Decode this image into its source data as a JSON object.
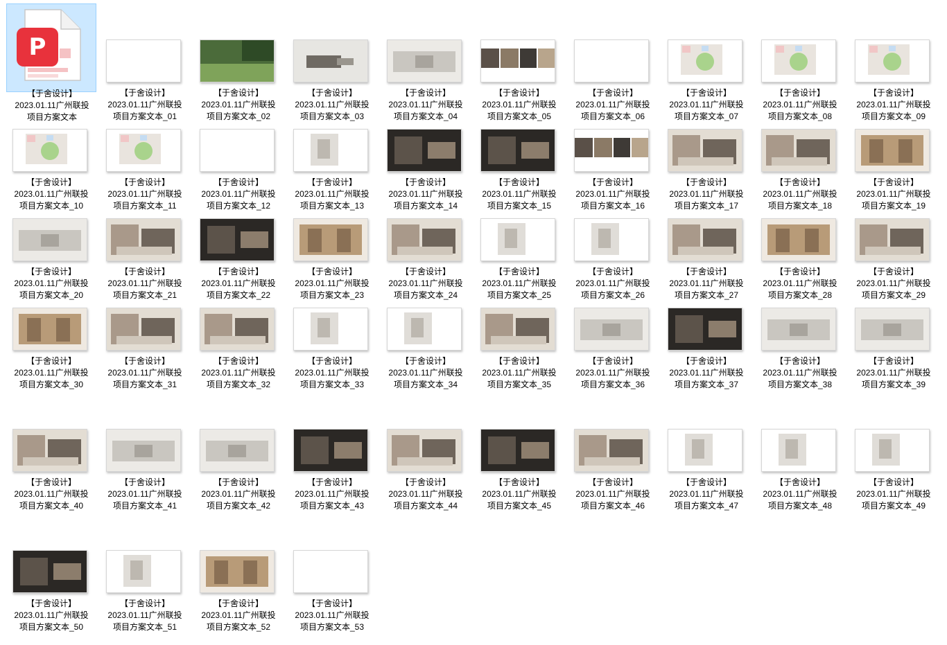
{
  "window": {
    "view": "large-icons"
  },
  "files": [
    {
      "l1": "【于舍设计】",
      "l2": "2023.01.11广州联投",
      "l3": "项目方案文本",
      "style": "pdf",
      "selected": true
    },
    {
      "l1": "【于舍设计】",
      "l2": "2023.01.11广州联投",
      "l3": "项目方案文本_01",
      "style": "blank"
    },
    {
      "l1": "【于舍设计】",
      "l2": "2023.01.11广州联投",
      "l3": "项目方案文本_02",
      "style": "green"
    },
    {
      "l1": "【于舍设计】",
      "l2": "2023.01.11广州联投",
      "l3": "项目方案文本_03",
      "style": "photo"
    },
    {
      "l1": "【于舍设计】",
      "l2": "2023.01.11广州联投",
      "l3": "项目方案文本_04",
      "style": "grey"
    },
    {
      "l1": "【于舍设计】",
      "l2": "2023.01.11广州联投",
      "l3": "项目方案文本_05",
      "style": "collage"
    },
    {
      "l1": "【于舍设计】",
      "l2": "2023.01.11广州联投",
      "l3": "项目方案文本_06",
      "style": "blank"
    },
    {
      "l1": "【于舍设计】",
      "l2": "2023.01.11广州联投",
      "l3": "项目方案文本_07",
      "style": "plan"
    },
    {
      "l1": "【于舍设计】",
      "l2": "2023.01.11广州联投",
      "l3": "项目方案文本_08",
      "style": "plan"
    },
    {
      "l1": "【于舍设计】",
      "l2": "2023.01.11广州联投",
      "l3": "项目方案文本_09",
      "style": "plan"
    },
    {
      "l1": "【于舍设计】",
      "l2": "2023.01.11广州联投",
      "l3": "项目方案文本_10",
      "style": "plan"
    },
    {
      "l1": "【于舍设计】",
      "l2": "2023.01.11广州联投",
      "l3": "项目方案文本_11",
      "style": "plan"
    },
    {
      "l1": "【于舍设计】",
      "l2": "2023.01.11广州联投",
      "l3": "项目方案文本_12",
      "style": "blank"
    },
    {
      "l1": "【于舍设计】",
      "l2": "2023.01.11广州联投",
      "l3": "项目方案文本_13",
      "style": "drawing"
    },
    {
      "l1": "【于舍设计】",
      "l2": "2023.01.11广州联投",
      "l3": "项目方案文本_14",
      "style": "dark"
    },
    {
      "l1": "【于舍设计】",
      "l2": "2023.01.11广州联投",
      "l3": "项目方案文本_15",
      "style": "dark"
    },
    {
      "l1": "【于舍设计】",
      "l2": "2023.01.11广州联投",
      "l3": "项目方案文本_16",
      "style": "collage"
    },
    {
      "l1": "【于舍设计】",
      "l2": "2023.01.11广州联投",
      "l3": "项目方案文本_17",
      "style": "interior"
    },
    {
      "l1": "【于舍设计】",
      "l2": "2023.01.11广州联投",
      "l3": "项目方案文本_18",
      "style": "interior"
    },
    {
      "l1": "【于舍设计】",
      "l2": "2023.01.11广州联投",
      "l3": "项目方案文本_19",
      "style": "wood"
    },
    {
      "l1": "【于舍设计】",
      "l2": "2023.01.11广州联投",
      "l3": "项目方案文本_20",
      "style": "grey"
    },
    {
      "l1": "【于舍设计】",
      "l2": "2023.01.11广州联投",
      "l3": "项目方案文本_21",
      "style": "interior"
    },
    {
      "l1": "【于舍设计】",
      "l2": "2023.01.11广州联投",
      "l3": "项目方案文本_22",
      "style": "dark"
    },
    {
      "l1": "【于舍设计】",
      "l2": "2023.01.11广州联投",
      "l3": "项目方案文本_23",
      "style": "wood"
    },
    {
      "l1": "【于舍设计】",
      "l2": "2023.01.11广州联投",
      "l3": "项目方案文本_24",
      "style": "interior"
    },
    {
      "l1": "【于舍设计】",
      "l2": "2023.01.11广州联投",
      "l3": "项目方案文本_25",
      "style": "drawing"
    },
    {
      "l1": "【于舍设计】",
      "l2": "2023.01.11广州联投",
      "l3": "项目方案文本_26",
      "style": "drawing"
    },
    {
      "l1": "【于舍设计】",
      "l2": "2023.01.11广州联投",
      "l3": "项目方案文本_27",
      "style": "interior"
    },
    {
      "l1": "【于舍设计】",
      "l2": "2023.01.11广州联投",
      "l3": "项目方案文本_28",
      "style": "wood"
    },
    {
      "l1": "【于舍设计】",
      "l2": "2023.01.11广州联投",
      "l3": "项目方案文本_29",
      "style": "interior"
    },
    {
      "l1": "【于舍设计】",
      "l2": "2023.01.11广州联投",
      "l3": "项目方案文本_30",
      "style": "wood"
    },
    {
      "l1": "【于舍设计】",
      "l2": "2023.01.11广州联投",
      "l3": "项目方案文本_31",
      "style": "interior"
    },
    {
      "l1": "【于舍设计】",
      "l2": "2023.01.11广州联投",
      "l3": "项目方案文本_32",
      "style": "interior"
    },
    {
      "l1": "【于舍设计】",
      "l2": "2023.01.11广州联投",
      "l3": "项目方案文本_33",
      "style": "drawing"
    },
    {
      "l1": "【于舍设计】",
      "l2": "2023.01.11广州联投",
      "l3": "项目方案文本_34",
      "style": "drawing"
    },
    {
      "l1": "【于舍设计】",
      "l2": "2023.01.11广州联投",
      "l3": "项目方案文本_35",
      "style": "interior"
    },
    {
      "l1": "【于舍设计】",
      "l2": "2023.01.11广州联投",
      "l3": "项目方案文本_36",
      "style": "grey"
    },
    {
      "l1": "【于舍设计】",
      "l2": "2023.01.11广州联投",
      "l3": "项目方案文本_37",
      "style": "dark"
    },
    {
      "l1": "【于舍设计】",
      "l2": "2023.01.11广州联投",
      "l3": "项目方案文本_38",
      "style": "grey"
    },
    {
      "l1": "【于舍设计】",
      "l2": "2023.01.11广州联投",
      "l3": "项目方案文本_39",
      "style": "grey"
    },
    {
      "l1": "【于舍设计】",
      "l2": "2023.01.11广州联投",
      "l3": "项目方案文本_40",
      "style": "interior"
    },
    {
      "l1": "【于舍设计】",
      "l2": "2023.01.11广州联投",
      "l3": "项目方案文本_41",
      "style": "grey"
    },
    {
      "l1": "【于舍设计】",
      "l2": "2023.01.11广州联投",
      "l3": "项目方案文本_42",
      "style": "grey"
    },
    {
      "l1": "【于舍设计】",
      "l2": "2023.01.11广州联投",
      "l3": "项目方案文本_43",
      "style": "dark"
    },
    {
      "l1": "【于舍设计】",
      "l2": "2023.01.11广州联投",
      "l3": "项目方案文本_44",
      "style": "interior"
    },
    {
      "l1": "【于舍设计】",
      "l2": "2023.01.11广州联投",
      "l3": "项目方案文本_45",
      "style": "dark"
    },
    {
      "l1": "【于舍设计】",
      "l2": "2023.01.11广州联投",
      "l3": "项目方案文本_46",
      "style": "interior"
    },
    {
      "l1": "【于舍设计】",
      "l2": "2023.01.11广州联投",
      "l3": "项目方案文本_47",
      "style": "drawing"
    },
    {
      "l1": "【于舍设计】",
      "l2": "2023.01.11广州联投",
      "l3": "项目方案文本_48",
      "style": "drawing"
    },
    {
      "l1": "【于舍设计】",
      "l2": "2023.01.11广州联投",
      "l3": "项目方案文本_49",
      "style": "drawing"
    },
    {
      "l1": "【于舍设计】",
      "l2": "2023.01.11广州联投",
      "l3": "项目方案文本_50",
      "style": "dark"
    },
    {
      "l1": "【于舍设计】",
      "l2": "2023.01.11广州联投",
      "l3": "项目方案文本_51",
      "style": "drawing"
    },
    {
      "l1": "【于舍设计】",
      "l2": "2023.01.11广州联投",
      "l3": "项目方案文本_52",
      "style": "wood"
    },
    {
      "l1": "【于舍设计】",
      "l2": "2023.01.11广州联投",
      "l3": "项目方案文本_53",
      "style": "blank"
    }
  ],
  "colors": {
    "selection_bg": "#cce8ff",
    "selection_border": "#99d1ff",
    "pdf_red": "#e8323c"
  }
}
